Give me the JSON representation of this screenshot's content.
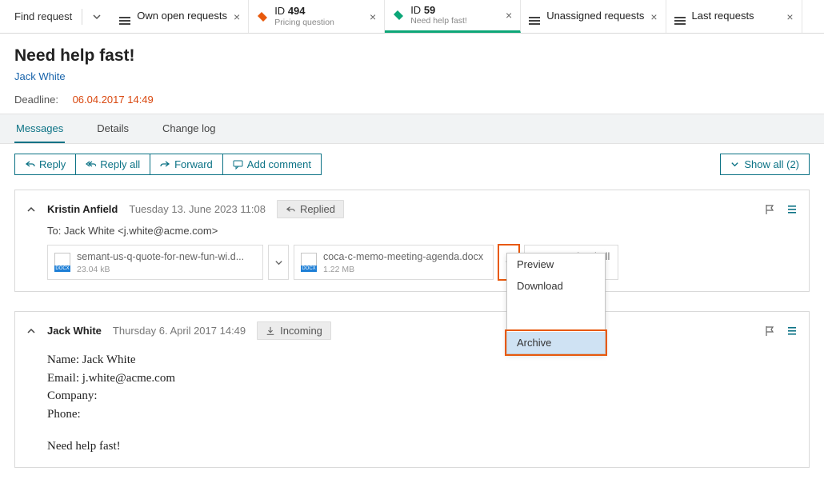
{
  "topbar": {
    "find_label": "Find request",
    "tabs": [
      {
        "kind": "list",
        "title": "Own open requests"
      },
      {
        "kind": "ticket",
        "id_prefix": "ID",
        "id": "494",
        "subtitle": "Pricing question",
        "color": "red"
      },
      {
        "kind": "ticket",
        "id_prefix": "ID",
        "id": "59",
        "subtitle": "Need help fast!",
        "color": "green",
        "active": true
      },
      {
        "kind": "list",
        "title": "Unassigned requests"
      },
      {
        "kind": "list",
        "title": "Last requests"
      }
    ]
  },
  "header": {
    "title": "Need help fast!",
    "person": "Jack White",
    "deadline_label": "Deadline:",
    "deadline_value": "06.04.2017 14:49"
  },
  "subtabs": {
    "items": [
      "Messages",
      "Details",
      "Change log"
    ],
    "active": 0
  },
  "toolbar": {
    "reply": "Reply",
    "reply_all": "Reply all",
    "forward": "Forward",
    "add_comment": "Add comment",
    "show_all": "Show all (2)"
  },
  "messages": [
    {
      "sender": "Kristin Anfield",
      "date": "Tuesday 13. June 2023 11:08",
      "status_label": "Replied",
      "status_icon": "reply",
      "to": "To: Jack White <j.white@acme.com>",
      "attachments": [
        {
          "name": "semant-us-q-quote-for-new-fun-wi.d...",
          "size": "23.04 kB"
        },
        {
          "name": "coca-c-memo-meeting-agenda.docx",
          "size": "1.22 MB"
        }
      ],
      "download_all_label": "Download all",
      "download_all_size": "1.25 MB",
      "attachment_menu": {
        "items": [
          "Preview",
          "Download",
          "Archive"
        ],
        "selected": 2
      }
    },
    {
      "sender": "Jack White",
      "date": "Thursday 6. April 2017 14:49",
      "status_label": "Incoming",
      "status_icon": "incoming",
      "body": {
        "line1": "Name: Jack White",
        "line2": "Email: j.white@acme.com",
        "line3": "Company:",
        "line4": "Phone:",
        "line5": "Need help fast!"
      }
    }
  ]
}
